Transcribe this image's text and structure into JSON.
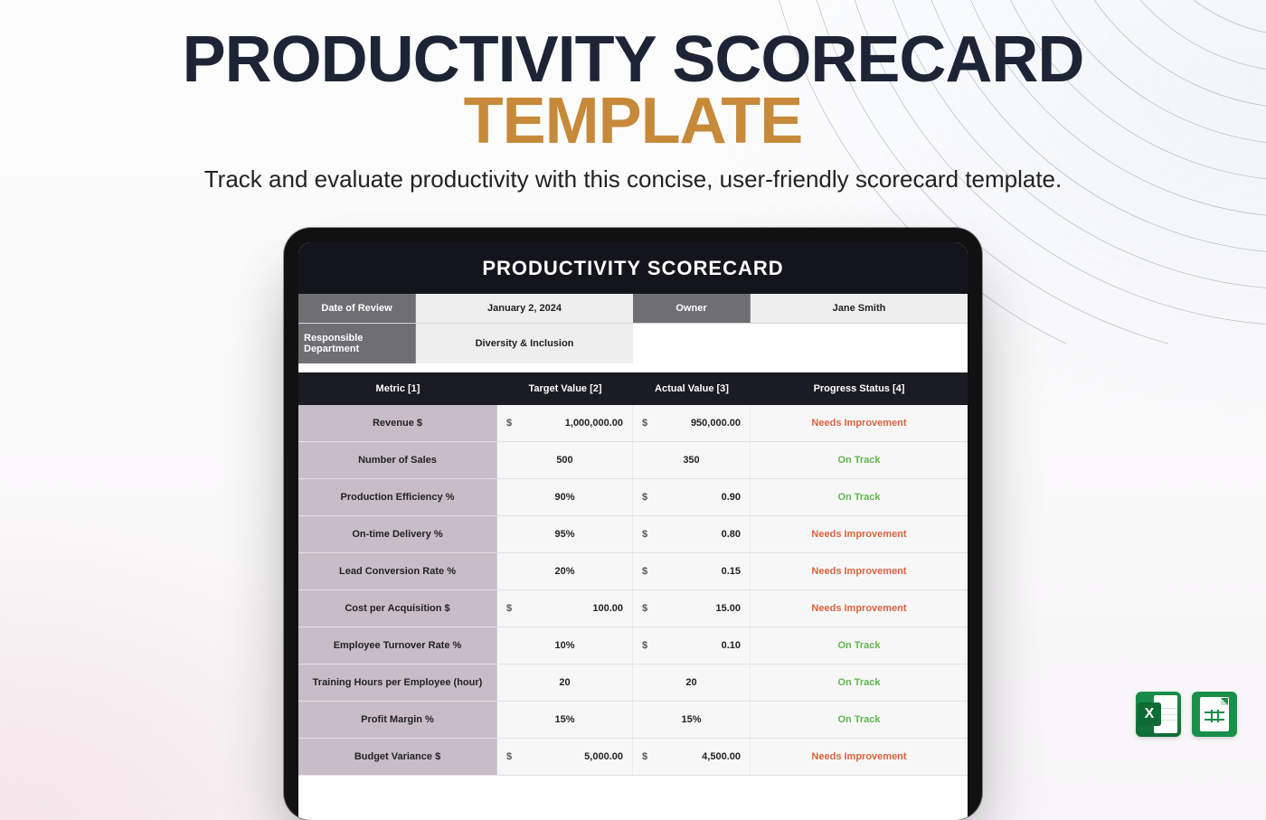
{
  "hero": {
    "line1": "PRODUCTIVITY SCORECARD",
    "line2": "TEMPLATE",
    "subtitle": "Track and evaluate productivity with this concise, user-friendly scorecard template."
  },
  "scorecard": {
    "title": "PRODUCTIVITY SCORECARD",
    "meta": {
      "date_label": "Date of Review",
      "date_value": "January 2, 2024",
      "owner_label": "Owner",
      "owner_value": "Jane Smith",
      "dept_label": "Responsible Department",
      "dept_value": "Diversity & Inclusion"
    },
    "headers": {
      "metric": "Metric [1]",
      "target": "Target Value [2]",
      "actual": "Actual Value [3]",
      "status": "Progress Status [4]"
    },
    "status_labels": {
      "needs_improvement": "Needs Improvement",
      "on_track": "On Track"
    },
    "rows": [
      {
        "metric": "Revenue $",
        "target_sym": "$",
        "target": "1,000,000.00",
        "actual_sym": "$",
        "actual": "950,000.00",
        "status": "needs_improvement"
      },
      {
        "metric": "Number of Sales",
        "target_sym": "",
        "target": "500",
        "actual_sym": "",
        "actual": "350",
        "status": "on_track"
      },
      {
        "metric": "Production Efficiency %",
        "target_sym": "",
        "target": "90%",
        "actual_sym": "$",
        "actual": "0.90",
        "status": "on_track"
      },
      {
        "metric": "On-time Delivery %",
        "target_sym": "",
        "target": "95%",
        "actual_sym": "$",
        "actual": "0.80",
        "status": "needs_improvement"
      },
      {
        "metric": "Lead Conversion Rate %",
        "target_sym": "",
        "target": "20%",
        "actual_sym": "$",
        "actual": "0.15",
        "status": "needs_improvement"
      },
      {
        "metric": "Cost per Acquisition $",
        "target_sym": "$",
        "target": "100.00",
        "actual_sym": "$",
        "actual": "15.00",
        "status": "needs_improvement"
      },
      {
        "metric": "Employee Turnover Rate %",
        "target_sym": "",
        "target": "10%",
        "actual_sym": "$",
        "actual": "0.10",
        "status": "on_track"
      },
      {
        "metric": "Training Hours per Employee (hour)",
        "target_sym": "",
        "target": "20",
        "actual_sym": "",
        "actual": "20",
        "status": "on_track"
      },
      {
        "metric": "Profit Margin %",
        "target_sym": "",
        "target": "15%",
        "actual_sym": "",
        "actual": "15%",
        "status": "on_track"
      },
      {
        "metric": "Budget Variance $",
        "target_sym": "$",
        "target": "5,000.00",
        "actual_sym": "$",
        "actual": "4,500.00",
        "status": "needs_improvement"
      }
    ]
  },
  "apps": {
    "excel": "X"
  }
}
